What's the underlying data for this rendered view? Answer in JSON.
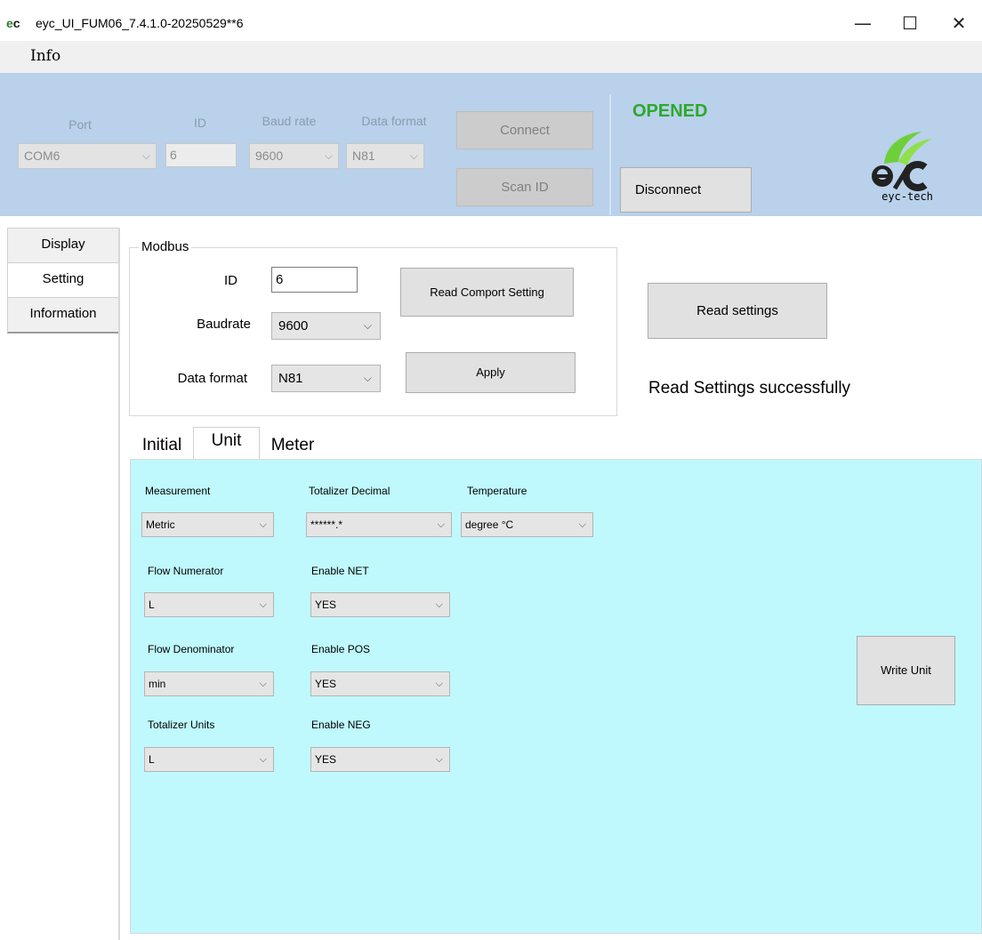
{
  "window": {
    "title": "eyc_UI_FUM06_7.4.1.0-20250529**6",
    "icon_text_e": "e",
    "icon_text_c": "c",
    "minimize_glyph": "—",
    "maximize_glyph": "☐",
    "close_glyph": "✕"
  },
  "menu": {
    "items": [
      {
        "label": "Info"
      }
    ]
  },
  "connection": {
    "port_label": "Port",
    "id_label": "ID",
    "baud_label": "Baud rate",
    "dataformat_label": "Data format",
    "port_value": "COM6",
    "id_value": "6",
    "baud_value": "9600",
    "dataformat_value": "N81",
    "connect_label": "Connect",
    "scanid_label": "Scan ID",
    "status": "OPENED",
    "status_color": "#2da82d",
    "disconnect_label": "Disconnect",
    "logo_text": "eyc-tech",
    "arrow": "⌵"
  },
  "side_tabs": [
    {
      "label": "Display"
    },
    {
      "label": "Setting"
    },
    {
      "label": "Information"
    }
  ],
  "modbus": {
    "title": "Modbus",
    "id_label": "ID",
    "id_value": "6",
    "baudrate_label": "Baudrate",
    "baudrate_value": "9600",
    "dataformat_label": "Data format",
    "dataformat_value": "N81",
    "read_comport_label": "Read Comport Setting",
    "apply_label": "Apply"
  },
  "settings": {
    "read_settings_label": "Read settings",
    "status_message": "Read Settings successfully"
  },
  "inner_tabs": [
    {
      "label": "Initial"
    },
    {
      "label": "Unit"
    },
    {
      "label": "Meter"
    }
  ],
  "unit": {
    "panel_color": "#bff9fd",
    "measurement_label": "Measurement",
    "measurement_value": "Metric",
    "tot_decimal_label": "Totalizer Decimal",
    "tot_decimal_value": "******.*",
    "temperature_label": "Temperature",
    "temperature_value": "degree °C",
    "flow_num_label": "Flow Numerator",
    "flow_num_value": "L",
    "enable_net_label": "Enable NET",
    "enable_net_value": "YES",
    "flow_den_label": "Flow Denominator",
    "flow_den_value": "min",
    "enable_pos_label": "Enable POS",
    "enable_pos_value": "YES",
    "tot_units_label": "Totalizer Units",
    "tot_units_value": "L",
    "enable_neg_label": "Enable NEG",
    "enable_neg_value": "YES",
    "write_unit_label": "Write Unit"
  }
}
